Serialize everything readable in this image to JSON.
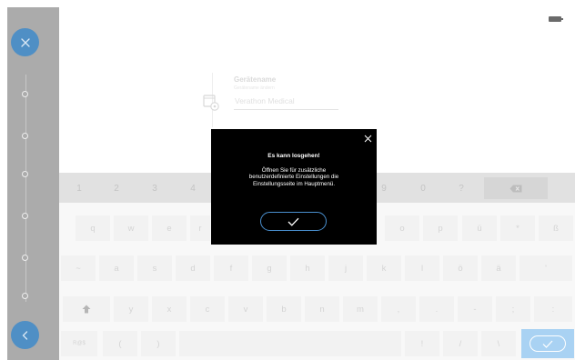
{
  "form": {
    "label": "Gerätename",
    "hint": "Gerätename ändern",
    "value": "Verathon Medical"
  },
  "dialog": {
    "title": "Es kann losgehen!",
    "message_lines": [
      "Öffnen Sie für zusätzliche",
      "benutzerdefinierte Einstellungen die",
      "Einstellungsseite im Hauptmenü."
    ]
  },
  "keyboard": {
    "number_row": [
      "1",
      "2",
      "3",
      "4",
      "9",
      "0",
      "?"
    ],
    "row1": [
      "q",
      "w",
      "e",
      "r",
      "o",
      "p",
      "ü",
      "*",
      "ß"
    ],
    "row2": [
      "~",
      "a",
      "s",
      "d",
      "f",
      "g",
      "h",
      "j",
      "k",
      "l",
      "ö",
      "ä",
      "'"
    ],
    "row3": [
      "y",
      "x",
      "c",
      "v",
      "b",
      "n",
      "m",
      ",",
      ".",
      "-",
      ";",
      ":"
    ],
    "row4": [
      "R@$",
      "(",
      ")",
      "!",
      "/",
      "\\"
    ]
  },
  "icons": {
    "close": "close-icon",
    "back": "chevron-left-icon",
    "device": "device-settings-icon",
    "battery": "battery-icon",
    "backspace": "backspace-icon",
    "shift": "shift-icon",
    "confirm": "checkmark-icon"
  },
  "colors": {
    "rail": "#ababab",
    "accent": "#4f8fc5",
    "dialog_bg": "#000000",
    "confirm_key": "#a9d2f3"
  }
}
